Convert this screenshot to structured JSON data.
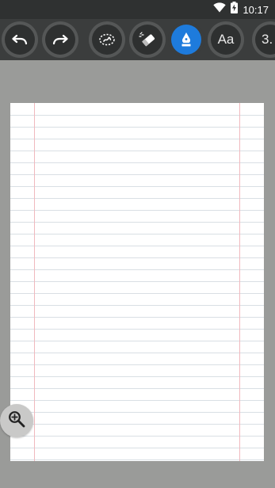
{
  "status_bar": {
    "time": "10:17",
    "icons": [
      "wifi-icon",
      "battery-charging-icon"
    ]
  },
  "toolbar": {
    "tools": [
      {
        "name": "undo",
        "icon": "undo-icon",
        "active": false
      },
      {
        "name": "redo",
        "icon": "redo-icon",
        "active": false
      },
      {
        "name": "lasso",
        "icon": "lasso-select-icon",
        "active": false
      },
      {
        "name": "eraser",
        "icon": "eraser-icon",
        "active": false
      },
      {
        "name": "pen",
        "icon": "fountain-pen-icon",
        "active": true
      },
      {
        "name": "text",
        "icon": "text-icon",
        "label": "Aa",
        "active": false
      },
      {
        "name": "size",
        "icon": "size-icon",
        "label": "3.",
        "active": false
      }
    ]
  },
  "canvas": {
    "paper_style": "lined",
    "paper_color": "#ffffff",
    "rule_color": "#d9dfe4",
    "margin_color": "#f0b9be",
    "background_color": "#9a9b99"
  },
  "zoom": {
    "icon": "zoom-in-icon"
  },
  "colors": {
    "accent": "#1e7bdc",
    "toolbar": "#3b3d3d",
    "status_bar": "#2f3131"
  }
}
